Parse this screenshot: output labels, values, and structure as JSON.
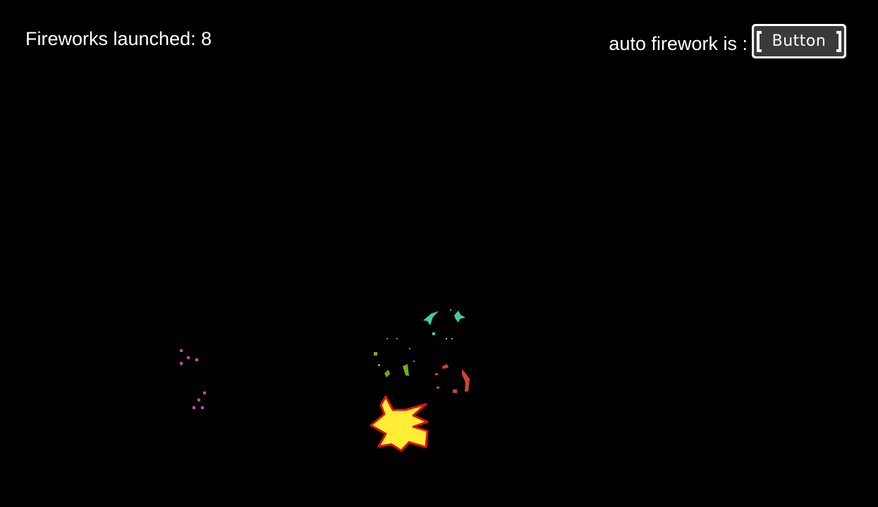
{
  "hud": {
    "counter_text": "Fireworks launched: 8",
    "auto_label": "auto firework is :",
    "auto_button_label": "Button"
  },
  "colors": {
    "background": "#000000",
    "text": "#ffffff",
    "button_bg": "#3a3a3a",
    "spark_magenta": "#cc44aa",
    "spark_teal": "#44ccaa",
    "spark_green": "#77aa22",
    "spark_red": "#cc4433",
    "burst_fill": "#ffee33",
    "burst_outline": "#dd1111"
  }
}
